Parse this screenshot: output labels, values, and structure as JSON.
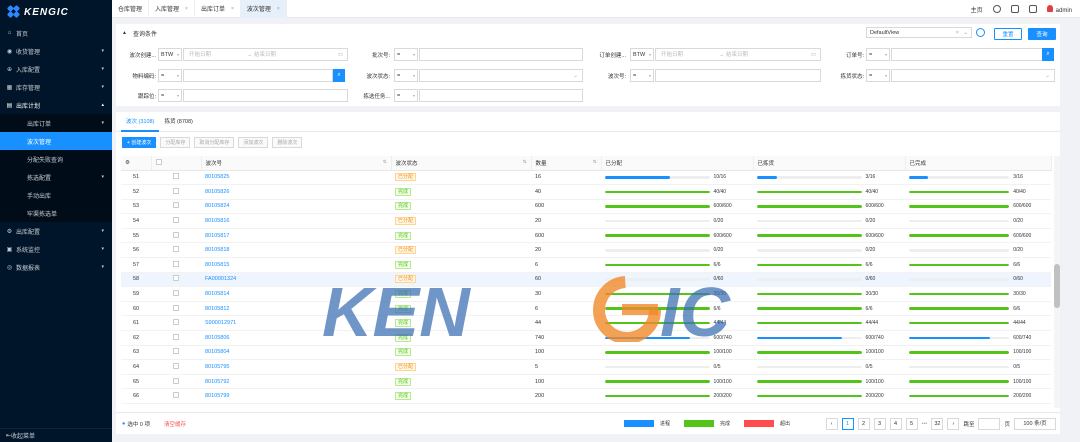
{
  "brand": "KENGIC",
  "sidebar": {
    "items": [
      {
        "label": "首页",
        "icon": "home-icon",
        "glyph": "⌂",
        "arrow": ""
      },
      {
        "label": "收货管理",
        "icon": "receive-icon",
        "glyph": "◉",
        "arrow": "▾"
      },
      {
        "label": "入库配置",
        "icon": "inbound-icon",
        "glyph": "⊕",
        "arrow": "▾"
      },
      {
        "label": "库存管理",
        "icon": "stock-icon",
        "glyph": "▦",
        "arrow": "▾"
      },
      {
        "label": "出库计划",
        "icon": "outbound-icon",
        "glyph": "▤",
        "arrow": "▴",
        "open": true
      },
      {
        "label": "出库订单",
        "sub": true,
        "arrow": "▾"
      },
      {
        "label": "波次管理",
        "sub": true,
        "active": true
      },
      {
        "label": "分配失败查询",
        "sub": true
      },
      {
        "label": "拣选配置",
        "sub": true,
        "arrow": "▾"
      },
      {
        "label": "手动出库",
        "sub": true
      },
      {
        "label": "牢渠拣选单",
        "sub": true
      },
      {
        "label": "出库配置",
        "icon": "config-icon",
        "glyph": "⚙",
        "arrow": "▾"
      },
      {
        "label": "系统监控",
        "icon": "monitor-icon",
        "glyph": "▣",
        "arrow": "▾"
      },
      {
        "label": "数据报表",
        "icon": "report-icon",
        "glyph": "◎",
        "arrow": "▾"
      }
    ],
    "collapse_label": "收起菜单"
  },
  "tabs": [
    {
      "label": "仓库管理",
      "close": ""
    },
    {
      "label": "入库管理",
      "close": "×"
    },
    {
      "label": "出库订单",
      "close": "×"
    },
    {
      "label": "波次管理",
      "close": "×",
      "active": true
    }
  ],
  "topright": {
    "home": "主页",
    "user": "admin"
  },
  "query": {
    "title": "查询条件",
    "view": "DefaultView",
    "reset": "重置",
    "search": "查询",
    "fields": {
      "wave_create": "波次创建...",
      "btw": "BTW",
      "start": "开始日期",
      "end": "结束日期",
      "arrow": "→",
      "batch": "批次号:",
      "eq": "=",
      "order_create": "订单创建...",
      "order_no": "订单号:",
      "material": "物料编码:",
      "wave_status": "波次状态:",
      "wave_no": "波次号:",
      "pick_status": "拣货状态:",
      "tracking": "跟踪位:",
      "pick_task": "拣选任务..."
    }
  },
  "grid": {
    "tabs": [
      "波次 (3108)",
      "拣货 (8708)"
    ],
    "buttons": [
      "+ 创建波次",
      "分配库存",
      "取消分配库存",
      "添加波次",
      "删除波次"
    ],
    "columns": [
      "",
      "",
      "波次号",
      "波次状态",
      "数量",
      "已分配",
      "已拣货",
      "已完成"
    ],
    "rows": [
      {
        "n": "51",
        "id": "80105825",
        "st": "已分配",
        "sc": "alloc",
        "q": "16",
        "a": [
          10,
          16
        ],
        "p": [
          3,
          16
        ],
        "d": [
          3,
          16
        ]
      },
      {
        "n": "52",
        "id": "80105826",
        "st": "完成",
        "sc": "done",
        "q": "40",
        "a": [
          40,
          40
        ],
        "p": [
          40,
          40
        ],
        "d": [
          40,
          40
        ]
      },
      {
        "n": "53",
        "id": "80105824",
        "st": "完成",
        "sc": "done",
        "q": "600",
        "a": [
          600,
          600
        ],
        "p": [
          600,
          600
        ],
        "d": [
          600,
          600
        ]
      },
      {
        "n": "54",
        "id": "80105816",
        "st": "已分配",
        "sc": "alloc",
        "q": "20",
        "a": [
          0,
          20
        ],
        "p": [
          0,
          20
        ],
        "d": [
          0,
          20
        ]
      },
      {
        "n": "55",
        "id": "80105817",
        "st": "完成",
        "sc": "done",
        "q": "600",
        "a": [
          600,
          600
        ],
        "p": [
          600,
          600
        ],
        "d": [
          600,
          600
        ]
      },
      {
        "n": "56",
        "id": "80105818",
        "st": "已分配",
        "sc": "alloc",
        "q": "20",
        "a": [
          0,
          20
        ],
        "p": [
          0,
          20
        ],
        "d": [
          0,
          20
        ]
      },
      {
        "n": "57",
        "id": "80105815",
        "st": "完成",
        "sc": "done",
        "q": "6",
        "a": [
          6,
          6
        ],
        "p": [
          6,
          6
        ],
        "d": [
          6,
          6
        ]
      },
      {
        "n": "58",
        "id": "FA00001324",
        "st": "已分配",
        "sc": "alloc",
        "q": "60",
        "a": [
          0,
          60
        ],
        "p": [
          0,
          60
        ],
        "d": [
          0,
          60
        ],
        "hl": true
      },
      {
        "n": "59",
        "id": "80105814",
        "st": "完成",
        "sc": "done",
        "q": "30",
        "a": [
          30,
          30
        ],
        "p": [
          30,
          30
        ],
        "d": [
          30,
          30
        ]
      },
      {
        "n": "60",
        "id": "80105812",
        "st": "完成",
        "sc": "done",
        "q": "6",
        "a": [
          6,
          6
        ],
        "p": [
          6,
          6
        ],
        "d": [
          6,
          6
        ]
      },
      {
        "n": "61",
        "id": "S900012971",
        "st": "完成",
        "sc": "done",
        "q": "44",
        "a": [
          44,
          44
        ],
        "p": [
          44,
          44
        ],
        "d": [
          44,
          44
        ]
      },
      {
        "n": "62",
        "id": "80105806",
        "st": "完成",
        "sc": "done",
        "q": "740",
        "a": [
          600,
          740
        ],
        "p": [
          600,
          740
        ],
        "d": [
          600,
          740
        ],
        "blue": true
      },
      {
        "n": "63",
        "id": "80105804",
        "st": "完成",
        "sc": "done",
        "q": "100",
        "a": [
          100,
          100
        ],
        "p": [
          100,
          100
        ],
        "d": [
          100,
          100
        ]
      },
      {
        "n": "64",
        "id": "80105795",
        "st": "已分配",
        "sc": "alloc",
        "q": "5",
        "a": [
          0,
          5
        ],
        "p": [
          0,
          5
        ],
        "d": [
          0,
          5
        ]
      },
      {
        "n": "65",
        "id": "80105792",
        "st": "完成",
        "sc": "done",
        "q": "100",
        "a": [
          100,
          100
        ],
        "p": [
          100,
          100
        ],
        "d": [
          100,
          100
        ]
      },
      {
        "n": "66",
        "id": "80105799",
        "st": "完成",
        "sc": "done",
        "q": "200",
        "a": [
          200,
          200
        ],
        "p": [
          200,
          200
        ],
        "d": [
          200,
          200
        ]
      }
    ],
    "selected": "选中 0 项",
    "clear": "清空缓存",
    "legend": [
      {
        "label": "进程",
        "color": "#1890ff"
      },
      {
        "label": "完成",
        "color": "#52c41a"
      },
      {
        "label": "超出",
        "color": "#ff4d4f"
      }
    ],
    "pager": {
      "prev": "‹",
      "pages": [
        "1",
        "2",
        "3",
        "4",
        "5"
      ],
      "dots": "•••",
      "last": "32",
      "next": "›",
      "jump": "跳至",
      "page": "页",
      "size": "100 条/页"
    }
  }
}
